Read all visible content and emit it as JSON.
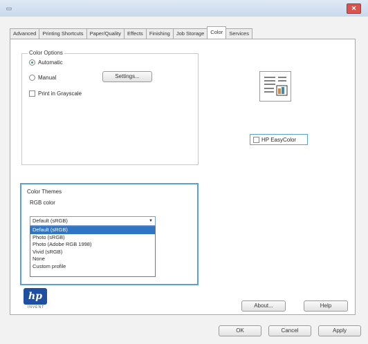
{
  "window": {
    "icon": "printer-icon",
    "close_glyph": "✕",
    "colors": {
      "titlebar": "#c9d9ec",
      "close": "#d9534f",
      "accent": "#5aa0d8",
      "selection": "#3074c4"
    }
  },
  "tabs": [
    {
      "label": "Advanced"
    },
    {
      "label": "Printing Shortcuts"
    },
    {
      "label": "Paper/Quality"
    },
    {
      "label": "Effects"
    },
    {
      "label": "Finishing"
    },
    {
      "label": "Job Storage"
    },
    {
      "label": "Color",
      "active": true
    },
    {
      "label": "Services"
    }
  ],
  "color_options": {
    "title": "Color Options",
    "automatic": "Automatic",
    "manual": "Manual",
    "settings_button": "Settings...",
    "print_grayscale": "Print in Grayscale",
    "selected": "automatic"
  },
  "easycolor": {
    "label": "HP EasyColor",
    "checked": false
  },
  "color_themes": {
    "title": "Color Themes",
    "sublabel": "RGB color",
    "selected": "Default (sRGB)",
    "options": [
      "Default (sRGB)",
      "Photo (sRGB)",
      "Photo (Adobe RGB 1998)",
      "Vivid (sRGB)",
      "None",
      "Custom profile"
    ]
  },
  "logo": {
    "text": "hp",
    "tagline": "INVENT"
  },
  "footer": {
    "about": "About...",
    "help": "Help",
    "ok": "OK",
    "cancel": "Cancel",
    "apply": "Apply"
  }
}
